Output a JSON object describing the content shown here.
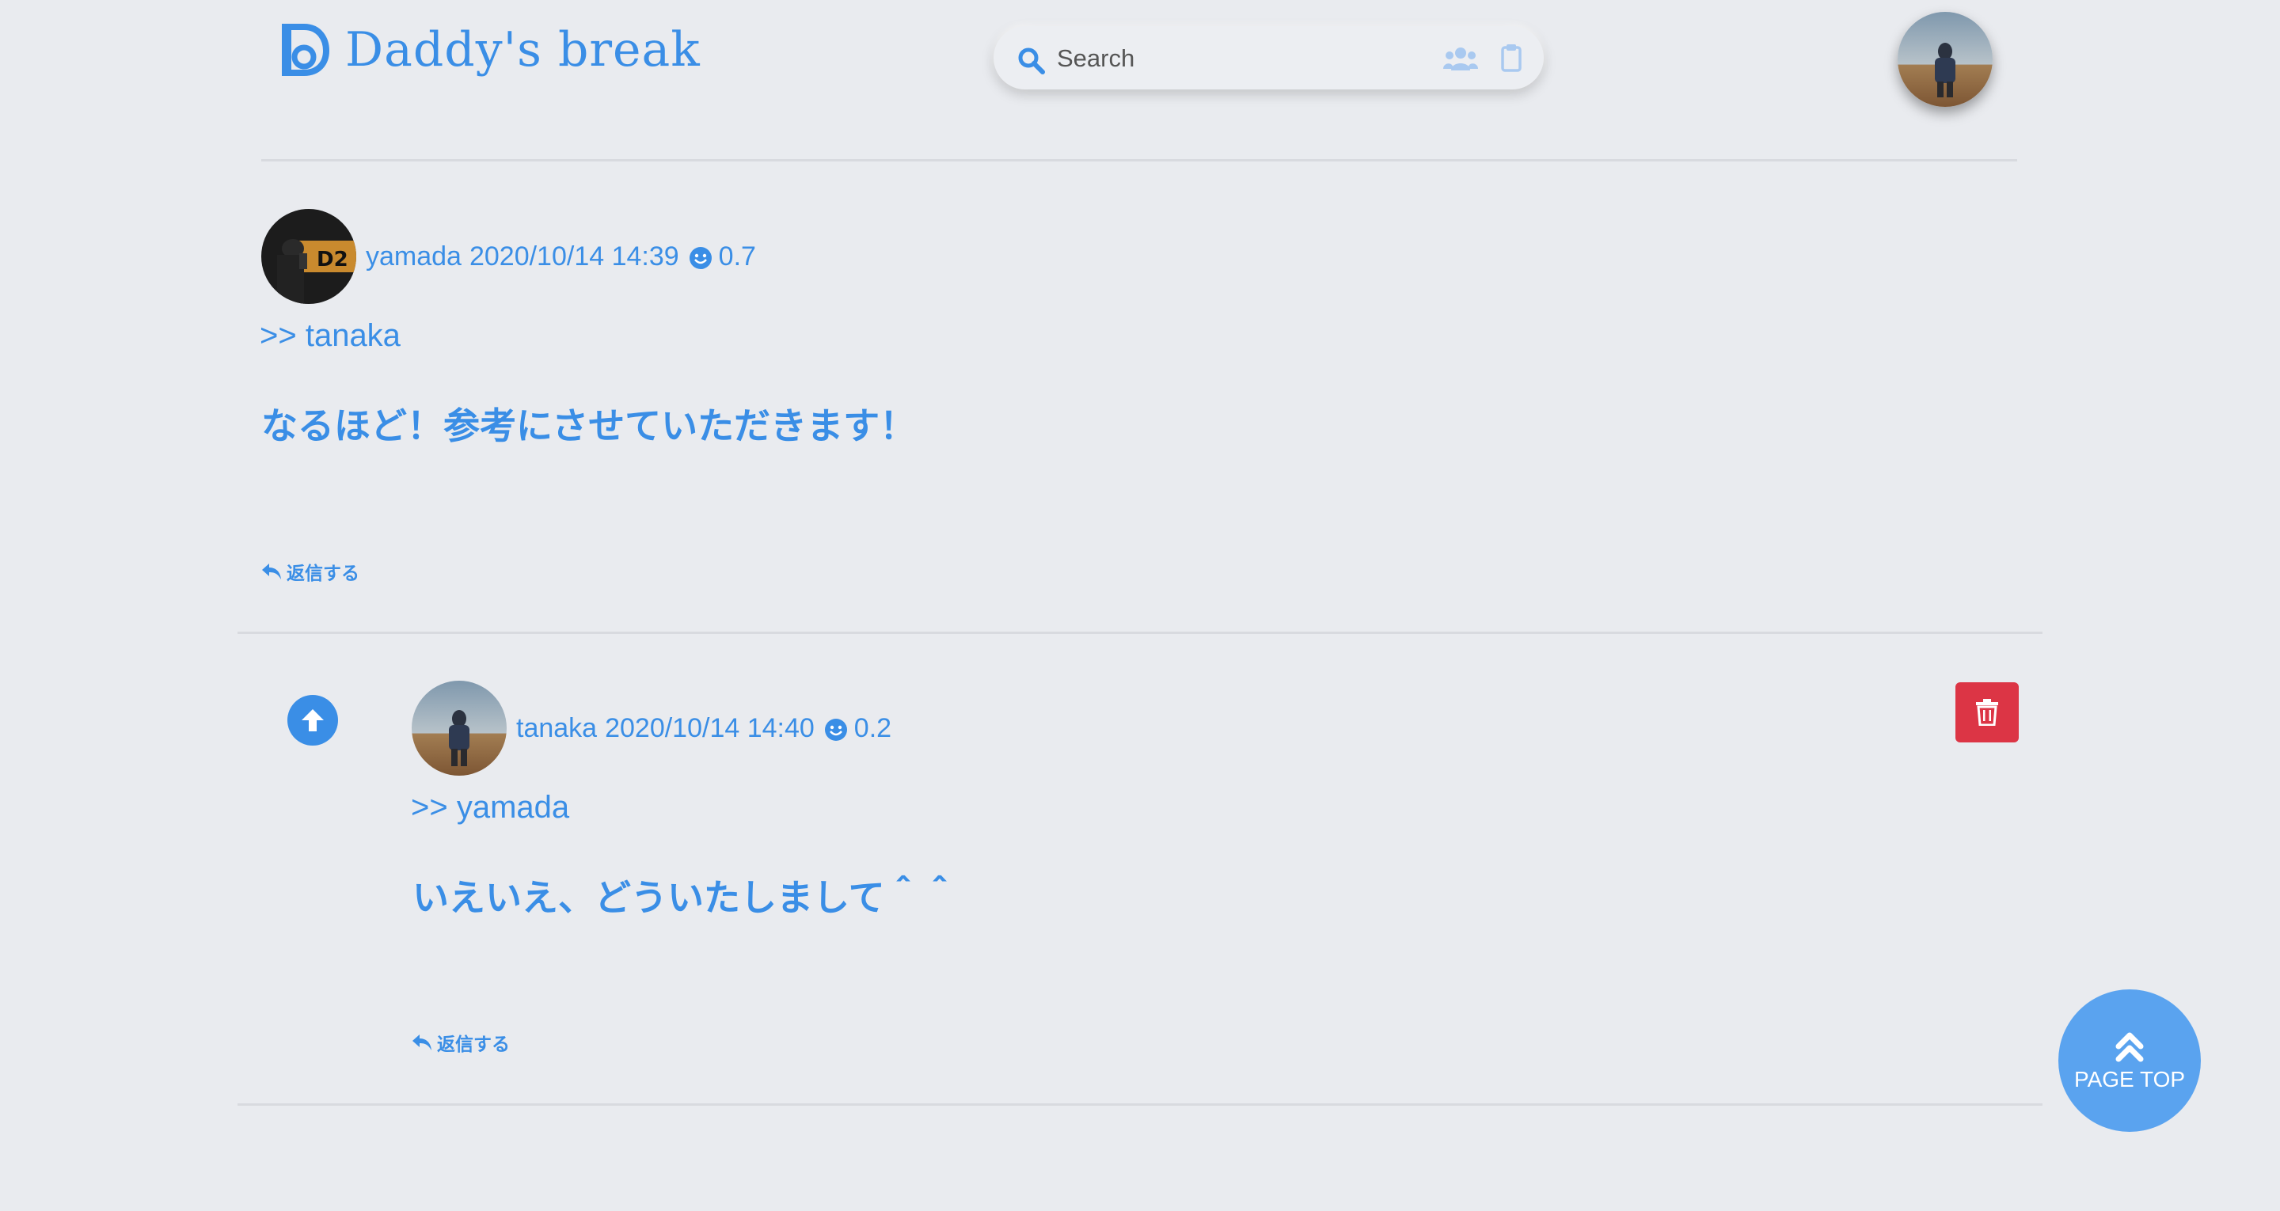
{
  "header": {
    "logo_text": "Daddy's break",
    "search_placeholder": "Search",
    "icons": [
      "search-icon",
      "users-icon",
      "clipboard-icon"
    ]
  },
  "comments": [
    {
      "author": "yamada",
      "datetime": "2020/10/14 14:39",
      "score": "0.7",
      "reply_to": ">> tanaka",
      "body": "なるほど！参考にさせていただきます！",
      "reply_label": "返信する"
    },
    {
      "author": "tanaka",
      "datetime": "2020/10/14 14:40",
      "score": "0.2",
      "reply_to": ">> yamada",
      "body": "いえいえ、どういたしまして＾＾",
      "reply_label": "返信する"
    }
  ],
  "page_top": {
    "label": "PAGE TOP"
  },
  "colors": {
    "accent": "#3a8ee6",
    "background": "#e9ebef",
    "danger": "#dc3545",
    "page_top_bg": "#5aa3ef"
  }
}
